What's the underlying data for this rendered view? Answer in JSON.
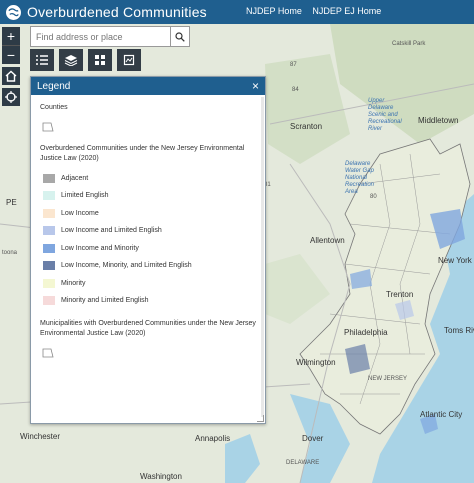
{
  "header": {
    "title": "Overburdened Communities",
    "links": [
      "NJDEP Home",
      "NJDEP EJ Home"
    ],
    "bg_color": "#1f5f8f"
  },
  "search": {
    "placeholder": "Find address or place",
    "icon": "search-icon"
  },
  "zoom": {
    "in": "+",
    "out": "−"
  },
  "toolbar": {
    "icons": [
      "legend-list-icon",
      "layers-icon",
      "basemap-grid-icon",
      "print-icon"
    ]
  },
  "legend": {
    "title": "Legend",
    "close": "×",
    "counties_label": "Counties",
    "obc_heading": "Overburdened Communities under the New Jersey Environmental Justice Law (2020)",
    "items": [
      {
        "label": "Adjacent",
        "color": "#a8a8a8"
      },
      {
        "label": "Limited English",
        "color": "#d7f2ee"
      },
      {
        "label": "Low Income",
        "color": "#fbe6cf"
      },
      {
        "label": "Low Income and Limited English",
        "color": "#b8c7ea"
      },
      {
        "label": "Low Income and Minority",
        "color": "#7fa6df"
      },
      {
        "label": "Low Income, Minority, and Limited English",
        "color": "#6a7fa8"
      },
      {
        "label": "Minority",
        "color": "#f4f7d2"
      },
      {
        "label": "Minority and Limited English",
        "color": "#f6dada"
      }
    ],
    "muni_heading": "Municipalities with Overburdened Communities under the New Jersey Environmental Justice Law (2020)"
  },
  "map_labels": {
    "catskill": "Catskill Park",
    "upper_delaware": "Upper Delaware Scenic and Recreational River",
    "scranton": "Scranton",
    "middletown": "Middletown",
    "delaware_gap": "Delaware Water Gap National Recreation Area",
    "allentown": "Allentown",
    "new_york": "New York",
    "trenton": "Trenton",
    "toms_river": "Toms River",
    "philadelphia": "Philadelphia",
    "wilmington": "Wilmington",
    "new_jersey": "NEW JERSEY",
    "atlantic_city": "Atlantic City",
    "dover": "Dover",
    "winchester": "Winchester",
    "annapolis": "Annapolis",
    "washington": "Washington",
    "delaware": "DELAWARE",
    "toona": "toona",
    "pe": "PE",
    "hw87": "87",
    "hw84": "84",
    "hw81": "81",
    "hw80": "80"
  }
}
